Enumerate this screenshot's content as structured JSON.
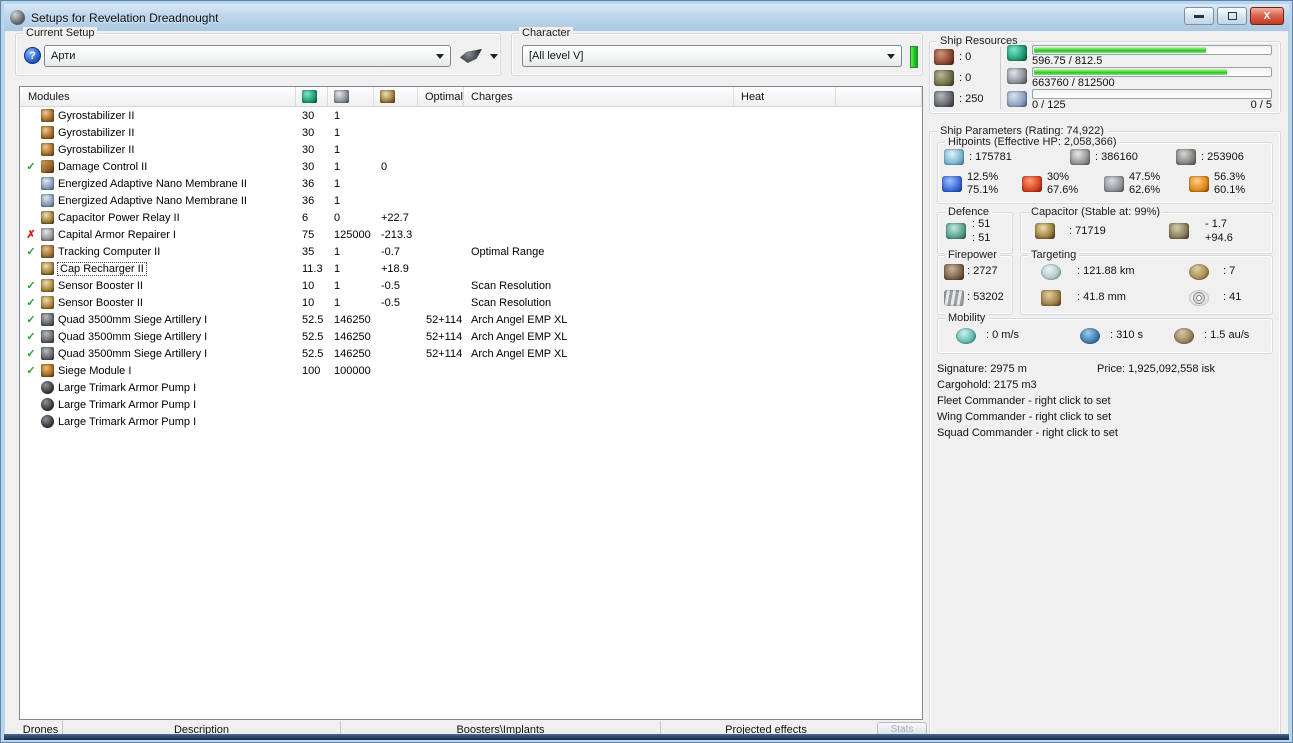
{
  "window": {
    "title": "Setups for Revelation Dreadnought"
  },
  "current_setup": {
    "label": "Current Setup",
    "value": "Арти"
  },
  "character": {
    "label": "Character",
    "value": "[All level V]"
  },
  "ship_resources": {
    "label": "Ship Resources",
    "turret_slots": ": 0",
    "launcher_slots": ": 0",
    "calibration": ": 250",
    "cpu_text": "596.75 / 812.5",
    "cpu_pct": 73,
    "pg_text": "663760 / 812500",
    "pg_pct": 82,
    "drone_text": "0 / 125",
    "drone_bandwidth_text": "0 / 5",
    "drone_pct": 0
  },
  "modules_table": {
    "header_modules": "Modules",
    "header_optimal": "Optimal",
    "header_charges": "Charges",
    "header_heat": "Heat",
    "status_glyphs": {
      "ok": "✓",
      "error": "✗"
    },
    "rows": [
      {
        "status": "",
        "icon": "gyrostabilizer-icon",
        "name": "Gyrostabilizer II",
        "cpu": "30",
        "pg": "1",
        "cap": "",
        "optimal": "",
        "charge": "",
        "focused": false
      },
      {
        "status": "",
        "icon": "gyrostabilizer-icon",
        "name": "Gyrostabilizer II",
        "cpu": "30",
        "pg": "1",
        "cap": "",
        "optimal": "",
        "charge": "",
        "focused": false
      },
      {
        "status": "",
        "icon": "gyrostabilizer-icon",
        "name": "Gyrostabilizer II",
        "cpu": "30",
        "pg": "1",
        "cap": "",
        "optimal": "",
        "charge": "",
        "focused": false
      },
      {
        "status": "ok",
        "icon": "damage-control-icon",
        "name": "Damage Control II",
        "cpu": "30",
        "pg": "1",
        "cap": "0",
        "optimal": "",
        "charge": "",
        "focused": false
      },
      {
        "status": "",
        "icon": "nano-membrane-icon",
        "name": "Energized Adaptive Nano Membrane II",
        "cpu": "36",
        "pg": "1",
        "cap": "",
        "optimal": "",
        "charge": "",
        "focused": false
      },
      {
        "status": "",
        "icon": "nano-membrane-icon",
        "name": "Energized Adaptive Nano Membrane II",
        "cpu": "36",
        "pg": "1",
        "cap": "",
        "optimal": "",
        "charge": "",
        "focused": false
      },
      {
        "status": "",
        "icon": "capacitor-relay-icon",
        "name": "Capacitor Power Relay II",
        "cpu": "6",
        "pg": "0",
        "cap": "+22.7",
        "optimal": "",
        "charge": "",
        "focused": false
      },
      {
        "status": "error",
        "icon": "armor-repairer-icon",
        "name": "Capital Armor Repairer I",
        "cpu": "75",
        "pg": "125000",
        "cap": "-213.3",
        "optimal": "",
        "charge": "",
        "focused": false
      },
      {
        "status": "ok",
        "icon": "tracking-computer-icon",
        "name": "Tracking Computer II",
        "cpu": "35",
        "pg": "1",
        "cap": "-0.7",
        "optimal": "",
        "charge": "Optimal Range",
        "focused": false
      },
      {
        "status": "",
        "icon": "cap-recharger-icon",
        "name": "Cap Recharger II",
        "cpu": "11.3",
        "pg": "1",
        "cap": "+18.9",
        "optimal": "",
        "charge": "",
        "focused": true
      },
      {
        "status": "ok",
        "icon": "sensor-booster-icon",
        "name": "Sensor Booster II",
        "cpu": "10",
        "pg": "1",
        "cap": "-0.5",
        "optimal": "",
        "charge": "Scan Resolution",
        "focused": false
      },
      {
        "status": "ok",
        "icon": "sensor-booster-icon",
        "name": "Sensor Booster II",
        "cpu": "10",
        "pg": "1",
        "cap": "-0.5",
        "optimal": "",
        "charge": "Scan Resolution",
        "focused": false
      },
      {
        "status": "ok",
        "icon": "siege-artillery-icon",
        "name": "Quad 3500mm Siege Artillery I",
        "cpu": "52.5",
        "pg": "146250",
        "cap": "",
        "optimal": "52+114",
        "charge": "Arch Angel EMP XL",
        "focused": false
      },
      {
        "status": "ok",
        "icon": "siege-artillery-icon",
        "name": "Quad 3500mm Siege Artillery I",
        "cpu": "52.5",
        "pg": "146250",
        "cap": "",
        "optimal": "52+114",
        "charge": "Arch Angel EMP XL",
        "focused": false
      },
      {
        "status": "ok",
        "icon": "siege-artillery-icon",
        "name": "Quad 3500mm Siege Artillery I",
        "cpu": "52.5",
        "pg": "146250",
        "cap": "",
        "optimal": "52+114",
        "charge": "Arch Angel EMP XL",
        "focused": false
      },
      {
        "status": "ok",
        "icon": "siege-module-icon",
        "name": "Siege Module I",
        "cpu": "100",
        "pg": "100000",
        "cap": "",
        "optimal": "",
        "charge": "",
        "focused": false
      },
      {
        "status": "",
        "icon": "armor-pump-icon",
        "name": "Large Trimark Armor Pump I",
        "cpu": "",
        "pg": "",
        "cap": "",
        "optimal": "",
        "charge": "",
        "focused": false
      },
      {
        "status": "",
        "icon": "armor-pump-icon",
        "name": "Large Trimark Armor Pump I",
        "cpu": "",
        "pg": "",
        "cap": "",
        "optimal": "",
        "charge": "",
        "focused": false
      },
      {
        "status": "",
        "icon": "armor-pump-icon",
        "name": "Large Trimark Armor Pump I",
        "cpu": "",
        "pg": "",
        "cap": "",
        "optimal": "",
        "charge": "",
        "focused": false
      }
    ]
  },
  "tabs": [
    {
      "label": "Drones"
    },
    {
      "label": "Description"
    },
    {
      "label": "Boosters\\Implants"
    },
    {
      "label": "Projected effects"
    }
  ],
  "stats_button": "Stats",
  "ship_parameters": {
    "label": "Ship Parameters (Rating: 74,922)",
    "hitpoints": {
      "label": "Hitpoints (Effective HP: 2,058,366)",
      "shield": ": 175781",
      "armor": ": 386160",
      "structure": ": 253906",
      "resists": [
        {
          "icon": "em-resist-icon",
          "line1": "12.5%",
          "line2": "75.1%"
        },
        {
          "icon": "thermal-resist-icon",
          "line1": "30%",
          "line2": "67.6%"
        },
        {
          "icon": "kinetic-resist-icon",
          "line1": "47.5%",
          "line2": "62.6%"
        },
        {
          "icon": "explosive-resist-icon",
          "line1": "56.3%",
          "line2": "60.1%"
        }
      ]
    },
    "defence": {
      "label": "Defence",
      "value1": ": 51",
      "value2": ": 51"
    },
    "capacitor": {
      "label": "Capacitor (Stable at: 99%)",
      "amount": ": 71719",
      "delta1": "- 1.7",
      "delta2": "+94.6"
    },
    "firepower": {
      "label": "Firepower",
      "dps": ": 2727",
      "volley": ": 53202"
    },
    "targeting": {
      "label": "Targeting",
      "range": ": 121.88 km",
      "sig_radius": ": 41.8 mm",
      "max_targets": ": 7",
      "scan_res": ": 41"
    },
    "mobility": {
      "label": "Mobility",
      "speed": ": 0 m/s",
      "align_time": ": 310 s",
      "warp_speed": ": 1.5 au/s"
    },
    "signature": "Signature: 2975 m",
    "price": "Price: 1,925,092,558 isk",
    "cargohold": "Cargohold: 2175 m3",
    "fleet_commander": "Fleet Commander - right click to set",
    "wing_commander": "Wing Commander - right click to set",
    "squad_commander": "Squad Commander - right click to set"
  },
  "colors": {
    "bar_green": "#2fc02c",
    "check_green": "#2f9e33",
    "error_red": "#cf2317",
    "skill_green": "#21c421"
  }
}
